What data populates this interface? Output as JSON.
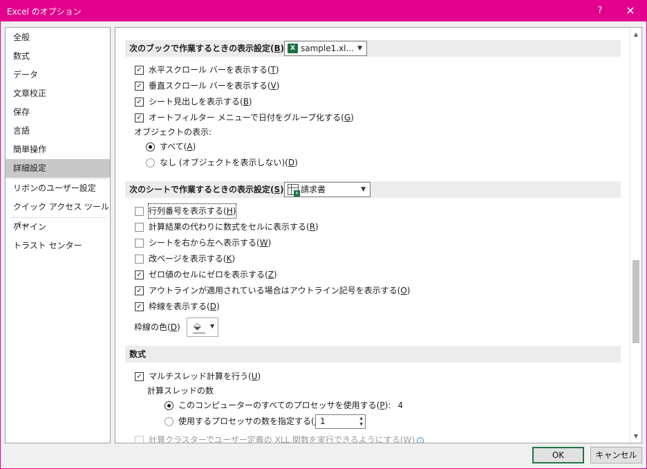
{
  "window": {
    "title": "Excel のオプション",
    "help_label": "?",
    "close_label": "✕"
  },
  "sidebar": {
    "items": [
      {
        "label": "全般"
      },
      {
        "label": "数式"
      },
      {
        "label": "データ"
      },
      {
        "label": "文章校正"
      },
      {
        "label": "保存"
      },
      {
        "label": "言語"
      },
      {
        "label": "簡単操作"
      },
      {
        "label": "詳細設定",
        "active": true
      },
      {
        "label": "リボンのユーザー設定"
      },
      {
        "label": "クイック アクセス ツール バー"
      },
      {
        "label": "アドイン"
      },
      {
        "label": "トラスト センター"
      }
    ]
  },
  "book_section": {
    "header_pre": "次のブックで作業するときの表示設定(",
    "header_key": "B",
    "header_post": "):",
    "combo_value": "sample1.xl...",
    "options": [
      {
        "pre": "水平スクロール バーを表示する(",
        "key": "T",
        "post": ")",
        "checked": true
      },
      {
        "pre": "垂直スクロール バーを表示する(",
        "key": "V",
        "post": ")",
        "checked": true
      },
      {
        "pre": "シート見出しを表示する(",
        "key": "B",
        "post": ")",
        "checked": true
      },
      {
        "pre": "オートフィルター メニューで日付をグループ化する(",
        "key": "G",
        "post": ")",
        "checked": true
      }
    ],
    "objects_label": "オブジェクトの表示:",
    "radios": [
      {
        "pre": "すべて(",
        "key": "A",
        "post": ")",
        "selected": true
      },
      {
        "pre": "なし (オブジェクトを表示しない)(",
        "key": "D",
        "post": ")",
        "selected": false
      }
    ]
  },
  "sheet_section": {
    "header_pre": "次のシートで作業するときの表示設定(",
    "header_key": "S",
    "header_post": "):",
    "combo_value": "請求書",
    "options": [
      {
        "pre": "行列番号を表示する(",
        "key": "H",
        "post": ")",
        "checked": false
      },
      {
        "pre": "計算結果の代わりに数式をセルに表示する(",
        "key": "R",
        "post": ")",
        "checked": false
      },
      {
        "pre": "シートを右から左へ表示する(",
        "key": "W",
        "post": ")",
        "checked": false
      },
      {
        "pre": "改ページを表示する(",
        "key": "K",
        "post": ")",
        "checked": false
      },
      {
        "pre": "ゼロ値のセルにゼロを表示する(",
        "key": "Z",
        "post": ")",
        "checked": true
      },
      {
        "pre": "アウトラインが適用されている場合はアウトライン記号を表示する(",
        "key": "O",
        "post": ")",
        "checked": true
      },
      {
        "pre": "枠線を表示する(",
        "key": "D",
        "post": ")",
        "checked": true
      }
    ],
    "gridline_color_pre": "枠線の色(",
    "gridline_color_key": "D",
    "gridline_color_post": ")"
  },
  "formula_section": {
    "header": "数式",
    "multithread_pre": "マルチスレッド計算を行う(",
    "multithread_key": "U",
    "multithread_post": ")",
    "threads_label": "計算スレッドの数",
    "all_processors_pre": "このコンピューターのすべてのプロセッサを使用する(",
    "all_processors_key": "P",
    "all_processors_post": "):",
    "processor_count": "4",
    "manual_pre": "使用するプロセッサの数を指定する(",
    "manual_key": "M",
    "manual_post": "):",
    "manual_value": "1",
    "xll_pre": "計算クラスターでユーザー定義の XLL 関数を実行できるようにする(",
    "xll_key": "W",
    "xll_post": ")"
  },
  "footer": {
    "ok_label": "OK",
    "cancel_label": "キャンセル"
  },
  "colors": {
    "titlebar": "#e3008c",
    "excel_green": "#1e7145",
    "active_item": "#c8c8c8"
  }
}
